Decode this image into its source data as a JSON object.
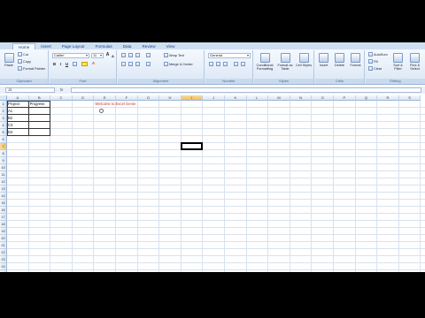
{
  "menu": {
    "tabs": [
      {
        "label": "Home",
        "active": true
      },
      {
        "label": "Insert"
      },
      {
        "label": "Page Layout"
      },
      {
        "label": "Formulas"
      },
      {
        "label": "Data"
      },
      {
        "label": "Review"
      },
      {
        "label": "View"
      }
    ]
  },
  "ribbon": {
    "clipboard": {
      "paste": "Paste",
      "cut": "Cut",
      "copy": "Copy",
      "format_painter": "Format Painter",
      "label": "Clipboard"
    },
    "font": {
      "name": "Calibri",
      "size": "11",
      "bold": "B",
      "italic": "I",
      "underline": "U",
      "label": "Font"
    },
    "alignment": {
      "wrap": "Wrap Text",
      "merge": "Merge & Center",
      "label": "Alignment"
    },
    "number": {
      "format": "General",
      "label": "Number"
    },
    "styles": {
      "conditional": "Conditional Formatting",
      "format_table": "Format as Table",
      "cell_styles": "Cell Styles",
      "label": "Styles"
    },
    "cells": {
      "insert": "Insert",
      "delete": "Delete",
      "format": "Format",
      "label": "Cells"
    },
    "editing": {
      "autosum": "AutoSum",
      "fill": "Fill",
      "clear": "Clear",
      "sort": "Sort & Filter",
      "find": "Find & Select",
      "label": "Editing"
    }
  },
  "formula_bar": {
    "name_box": "J3",
    "fx": "fx",
    "value": ""
  },
  "columns": [
    "A",
    "B",
    "C",
    "D",
    "E",
    "F",
    "G",
    "H",
    "I",
    "J",
    "K",
    "L",
    "M",
    "N",
    "O",
    "P",
    "Q",
    "R",
    "S"
  ],
  "selected_column": "I",
  "selected_row": 7,
  "rows": 25,
  "cells": {
    "A1": "Project",
    "B1": "Progress",
    "A2": "A1",
    "A3": "B2",
    "A4": "C3",
    "A5": "D4",
    "E1": "Welcome to Excel Genie"
  },
  "colors": {
    "accent": "#c0392b",
    "ribbon": "#dbe7f5"
  }
}
